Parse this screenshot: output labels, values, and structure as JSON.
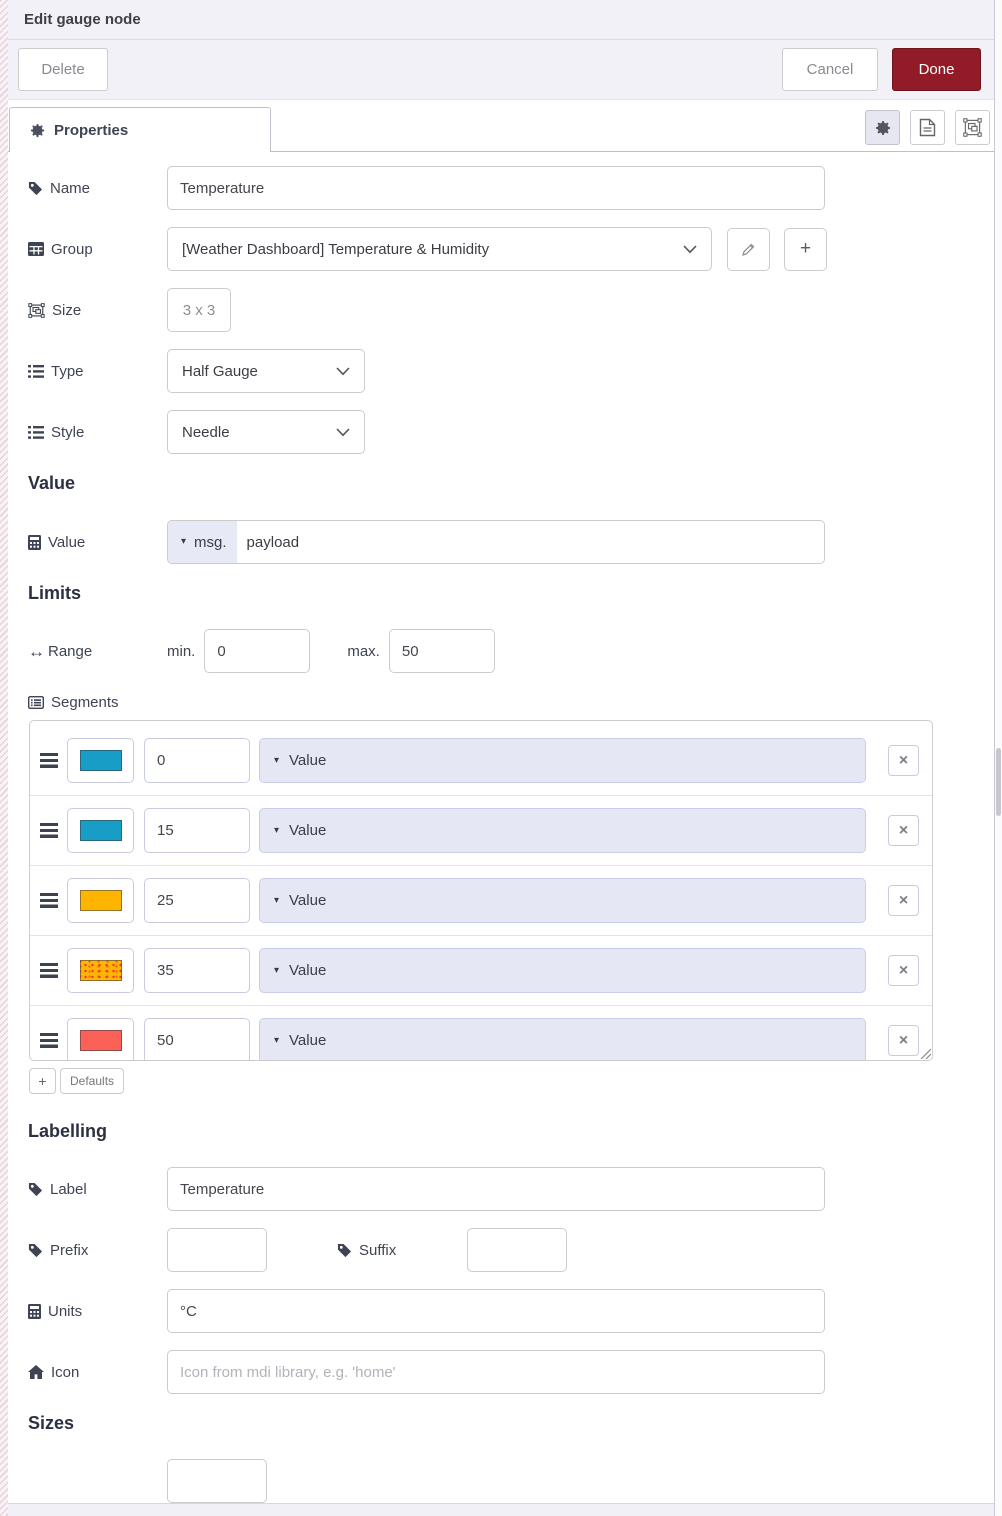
{
  "header": {
    "title": "Edit gauge node"
  },
  "actions": {
    "delete": "Delete",
    "cancel": "Cancel",
    "done": "Done"
  },
  "tab": {
    "label": "Properties"
  },
  "glyphs": {
    "caret": "▾",
    "arrows_h": "↔",
    "remove": "×",
    "add": "+"
  },
  "fields": {
    "name": {
      "label": "Name",
      "value": "Temperature"
    },
    "group": {
      "label": "Group",
      "value": "[Weather Dashboard] Temperature & Humidity"
    },
    "size": {
      "label": "Size",
      "value": "3 x 3"
    },
    "type": {
      "label": "Type",
      "value": "Half Gauge"
    },
    "style": {
      "label": "Style",
      "value": "Needle"
    }
  },
  "value_section": {
    "heading": "Value",
    "label": "Value",
    "prop_type": "msg.",
    "prop_value": "payload"
  },
  "limits_section": {
    "heading": "Limits",
    "range_label": "Range",
    "min_label": "min.",
    "min_value": "0",
    "max_label": "max.",
    "max_value": "50"
  },
  "segments": {
    "label": "Segments",
    "defaults_label": "Defaults",
    "rows": [
      {
        "color": "#189dc6",
        "value": "0",
        "type": "Value",
        "dotted": false
      },
      {
        "color": "#189dc6",
        "value": "15",
        "type": "Value",
        "dotted": false
      },
      {
        "color": "#ffb400",
        "value": "25",
        "type": "Value",
        "dotted": false
      },
      {
        "color": "#ffb504",
        "value": "35",
        "type": "Value",
        "dotted": true
      },
      {
        "color": "#fb6156",
        "value": "50",
        "type": "Value",
        "dotted": false
      }
    ]
  },
  "labelling_section": {
    "heading": "Labelling",
    "label_field": {
      "label": "Label",
      "value": "Temperature"
    },
    "prefix": {
      "label": "Prefix",
      "value": ""
    },
    "suffix": {
      "label": "Suffix",
      "value": ""
    },
    "units": {
      "label": "Units",
      "value": "°C"
    },
    "icon": {
      "label": "Icon",
      "placeholder": "Icon from mdi library, e.g. 'home'"
    }
  },
  "sizes_section": {
    "heading": "Sizes"
  },
  "colors": {
    "done_button": "#911c27"
  }
}
